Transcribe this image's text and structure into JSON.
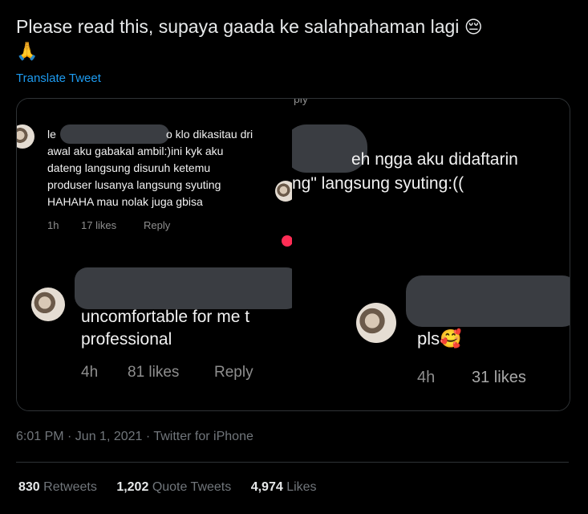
{
  "tweet": {
    "text": "Please read this, supaya gaada ke salahpahaman lagi",
    "emoji_pensive": "😔",
    "emoji_pray": "🙏",
    "translate_label": "Translate Tweet"
  },
  "media": {
    "left": {
      "comment1": {
        "line1_prefix": "le",
        "line1_suffix": "o klo dikasitau dri",
        "line2": "awal aku gabakal ambil:)ini kyk aku",
        "line3": "dateng langsung disuruh ketemu",
        "line4": "produser lusanya langsung syuting",
        "line5": "HAHAHA mau nolak juga gbisa",
        "time": "1h",
        "likes": "17 likes",
        "reply": "Reply"
      },
      "comment2": {
        "line1": "uncomfortable for me t",
        "line2": "professional",
        "time": "4h",
        "likes": "81 likes",
        "reply": "Reply"
      }
    },
    "right": {
      "comment1": {
        "line1": "eh ngga aku didaftarin",
        "line2": "ng\" langsung syuting:(("
      },
      "comment2": {
        "text": "pls",
        "emoji": "🥰",
        "time": "4h",
        "likes": "31 likes"
      },
      "top_fragment": "ply"
    }
  },
  "footer": {
    "timestamp": "6:01 PM · Jun 1, 2021 · Twitter for iPhone"
  },
  "stats": {
    "retweets_count": "830",
    "retweets_label": "Retweets",
    "quotes_count": "1,202",
    "quotes_label": "Quote Tweets",
    "likes_count": "4,974",
    "likes_label": "Likes"
  }
}
